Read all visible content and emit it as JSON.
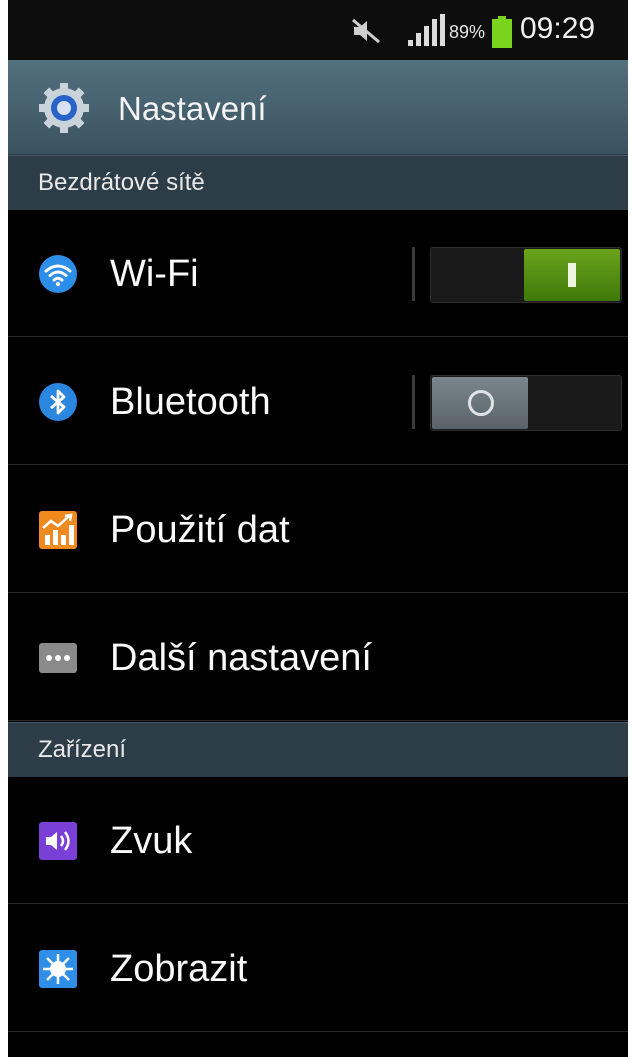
{
  "status_bar": {
    "battery_percent": "89%",
    "time": "09:29",
    "icons": [
      "mute-icon",
      "signal-icon",
      "battery-icon"
    ]
  },
  "action_bar": {
    "title": "Nastavení",
    "icon": "gear-icon"
  },
  "sections": [
    {
      "title": "Bezdrátové sítě",
      "items": [
        {
          "label": "Wi-Fi",
          "icon": "wifi-icon",
          "toggle": true,
          "toggle_state": "on"
        },
        {
          "label": "Bluetooth",
          "icon": "bluetooth-icon",
          "toggle": true,
          "toggle_state": "off"
        },
        {
          "label": "Použití dat",
          "icon": "data-usage-icon"
        },
        {
          "label": "Další nastavení",
          "icon": "more-icon"
        }
      ]
    },
    {
      "title": "Zařízení",
      "items": [
        {
          "label": "Zvuk",
          "icon": "sound-icon"
        },
        {
          "label": "Zobrazit",
          "icon": "display-icon"
        }
      ]
    }
  ],
  "colors": {
    "toggle_on": "#5a9416",
    "toggle_off": "#6e787e",
    "battery": "#7bd41c",
    "action_bar": "#48616f",
    "section_header": "#2c3d48"
  }
}
